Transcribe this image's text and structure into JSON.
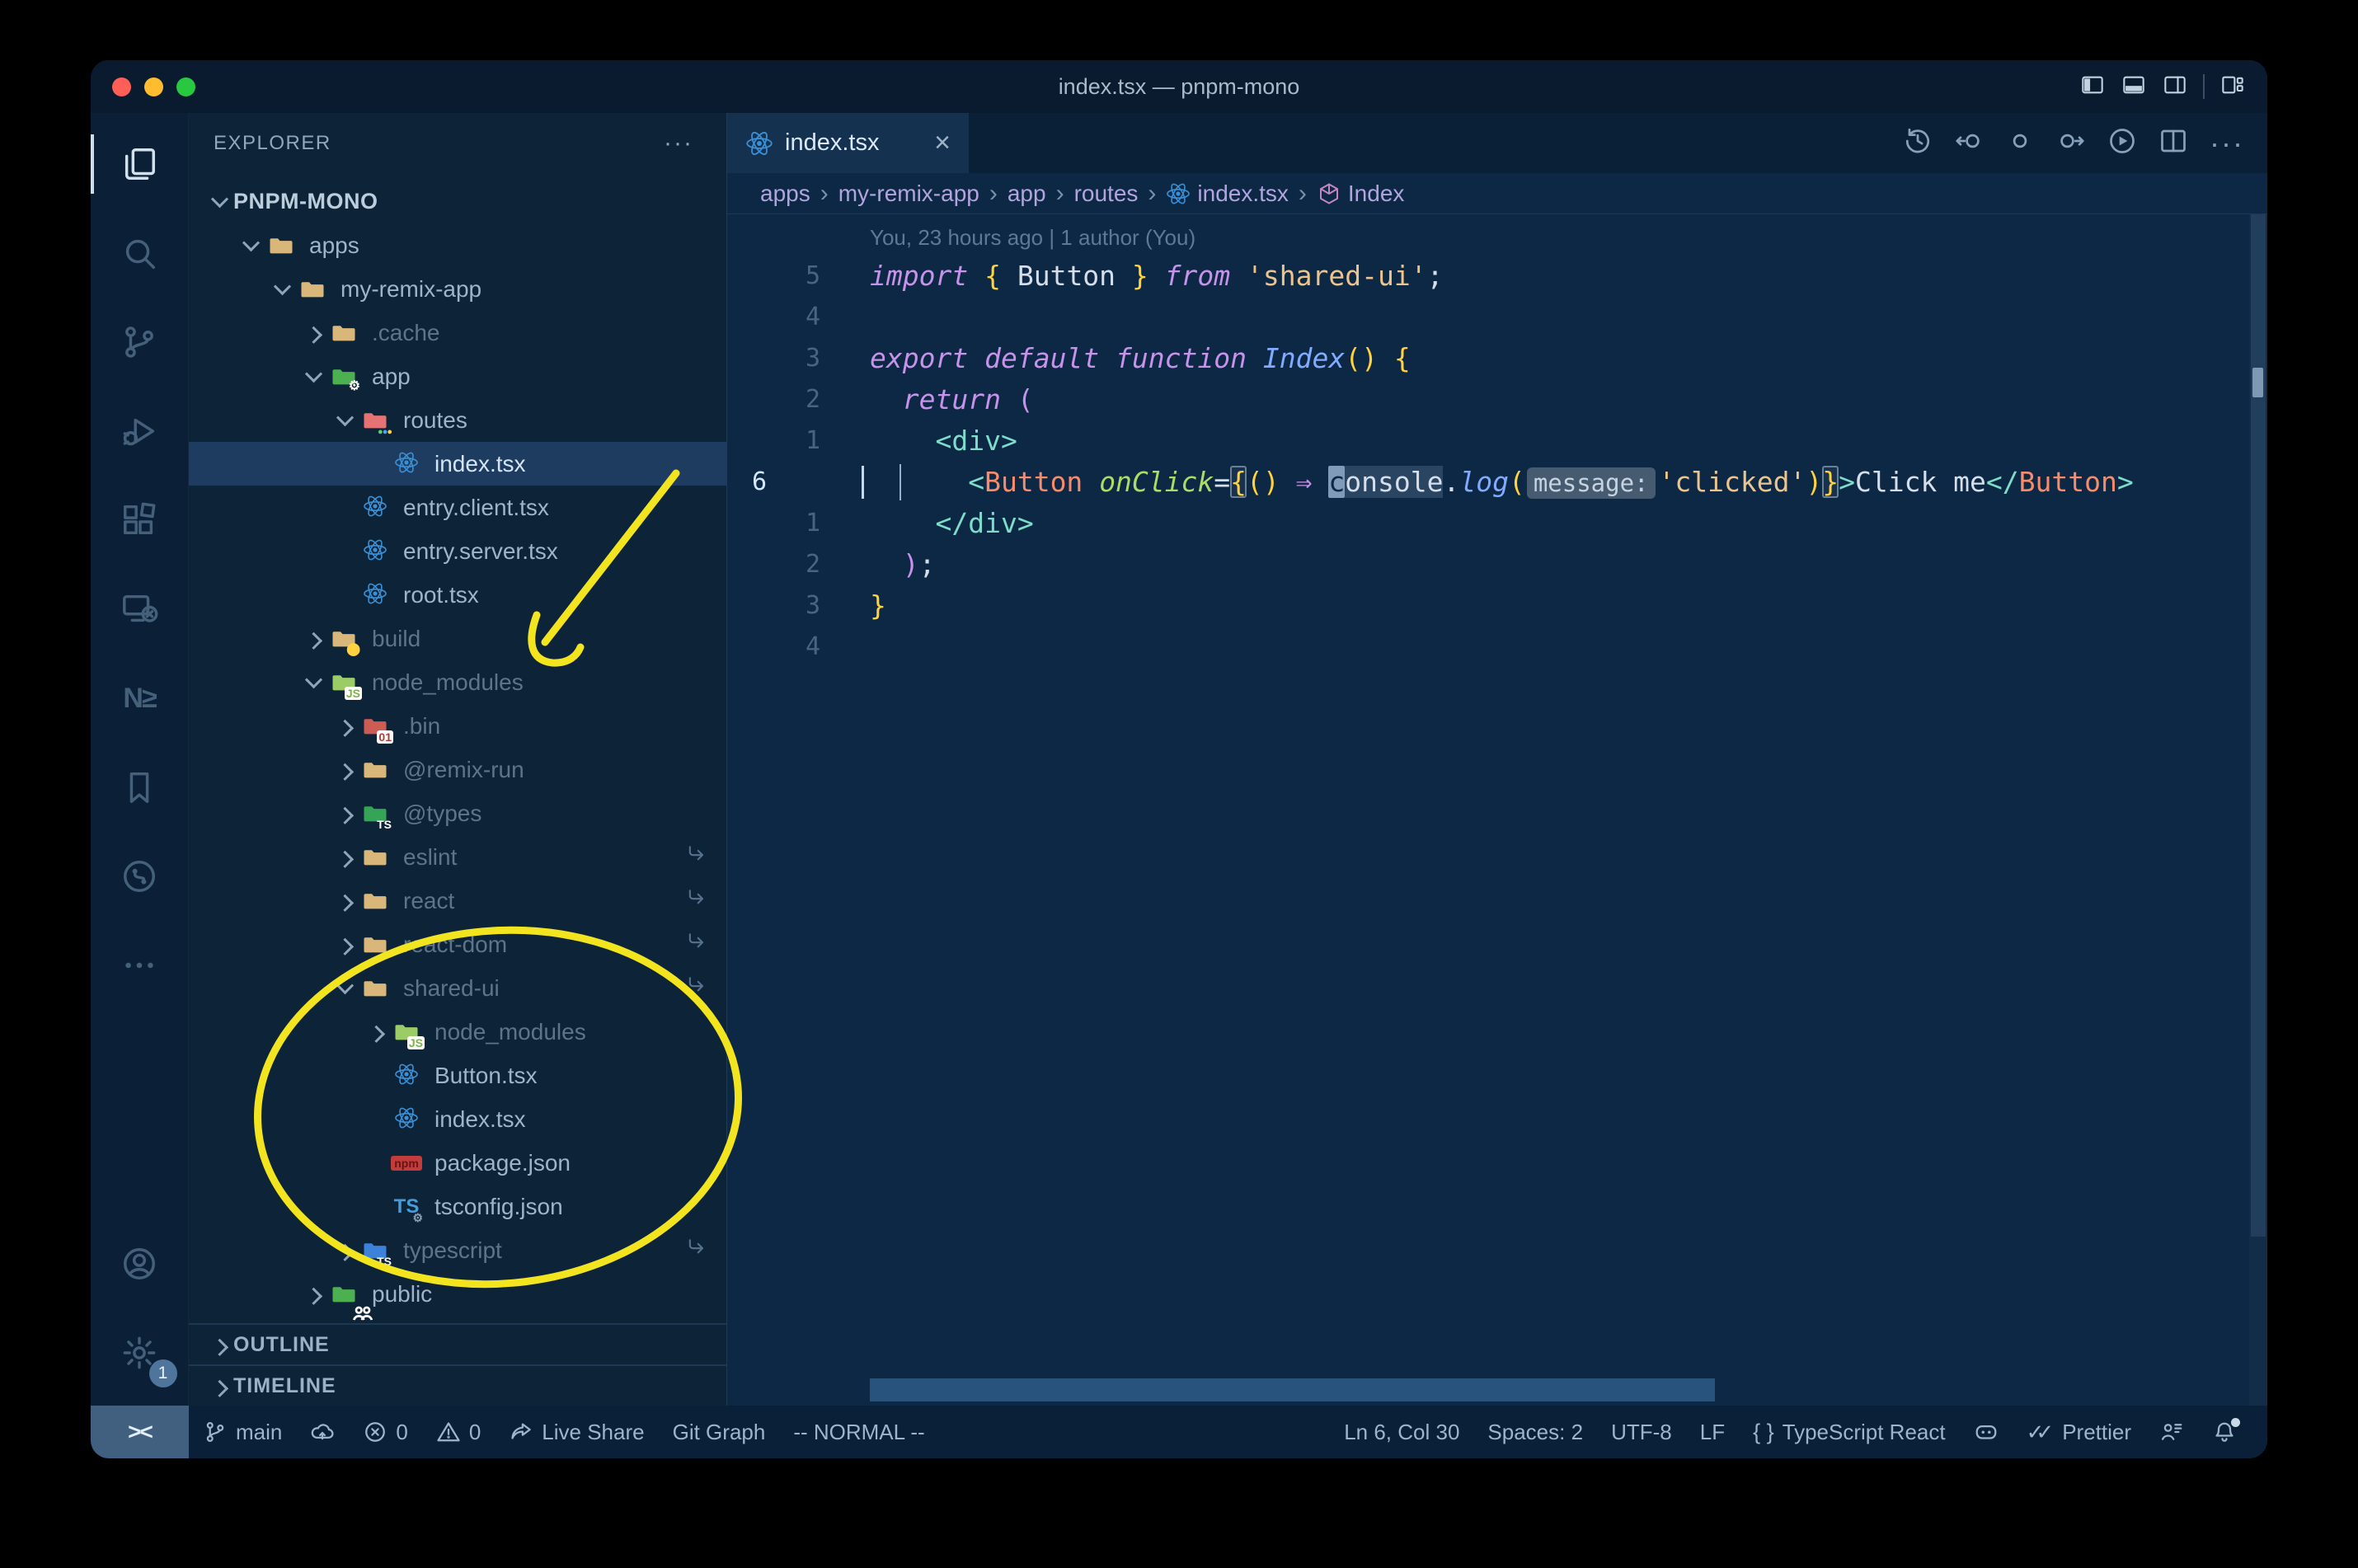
{
  "window": {
    "title": "index.tsx — pnpm-mono"
  },
  "colors": {
    "annotation_yellow": "#f2e41f",
    "editor_bg": "#0c2844",
    "sidebar_bg": "#0d2338",
    "react_blue": "#3b8fd4",
    "keyword_pink": "#c792ea",
    "string_peach": "#ecc48d",
    "bracket_yellow": "#ffd23e",
    "tag_teal": "#7fdbca",
    "component_salmon": "#f78c6c"
  },
  "title_bar": {
    "window_controls": [
      "close",
      "minimize",
      "zoom"
    ],
    "layout_icons": [
      "panel-left",
      "panel-bottom",
      "panel-right",
      "customize-layout"
    ]
  },
  "activity_bar": {
    "top": [
      {
        "name": "explorer",
        "icon": "files",
        "active": true
      },
      {
        "name": "search",
        "icon": "search",
        "active": false
      },
      {
        "name": "source-control",
        "icon": "scm",
        "active": false
      },
      {
        "name": "run-debug",
        "icon": "debug",
        "active": false
      },
      {
        "name": "extensions",
        "icon": "ext",
        "active": false
      },
      {
        "name": "remote-explorer",
        "icon": "remote",
        "active": false
      },
      {
        "name": "nx-console",
        "icon": "nx",
        "active": false,
        "text": "N≥"
      },
      {
        "name": "bookmarks",
        "icon": "bookmark",
        "active": false
      },
      {
        "name": "git-graph",
        "icon": "circlebranch",
        "active": false
      },
      {
        "name": "more-views",
        "icon": "more",
        "active": false
      }
    ],
    "bottom": [
      {
        "name": "accounts",
        "icon": "account"
      },
      {
        "name": "settings",
        "icon": "gear",
        "badge": "1"
      }
    ]
  },
  "sidebar": {
    "header": "EXPLORER",
    "header_menu": "···",
    "root": "PNPM-MONO",
    "tree": [
      {
        "label": "apps",
        "depth": 1,
        "icon": "folder-tan",
        "state": "open"
      },
      {
        "label": "my-remix-app",
        "depth": 2,
        "icon": "folder-tan",
        "state": "open"
      },
      {
        "label": ".cache",
        "depth": 3,
        "icon": "folder-tan",
        "state": "closed",
        "dim": true
      },
      {
        "label": "app",
        "depth": 3,
        "icon": "folder-app",
        "state": "open"
      },
      {
        "label": "routes",
        "depth": 4,
        "icon": "folder-routes",
        "state": "open"
      },
      {
        "label": "index.tsx",
        "depth": 5,
        "icon": "react",
        "state": "none",
        "selected": true
      },
      {
        "label": "entry.client.tsx",
        "depth": 4,
        "icon": "react",
        "state": "none"
      },
      {
        "label": "entry.server.tsx",
        "depth": 4,
        "icon": "react",
        "state": "none"
      },
      {
        "label": "root.tsx",
        "depth": 4,
        "icon": "react",
        "state": "none"
      },
      {
        "label": "build",
        "depth": 3,
        "icon": "folder-build",
        "state": "closed",
        "dim": true
      },
      {
        "label": "node_modules",
        "depth": 3,
        "icon": "folder-nm",
        "state": "open",
        "dim": true
      },
      {
        "label": ".bin",
        "depth": 4,
        "icon": "folder-bin",
        "state": "closed",
        "dim": true
      },
      {
        "label": "@remix-run",
        "depth": 4,
        "icon": "folder-tan",
        "state": "closed",
        "dim": true
      },
      {
        "label": "@types",
        "depth": 4,
        "icon": "folder-types",
        "state": "closed",
        "dim": true
      },
      {
        "label": "eslint",
        "depth": 4,
        "icon": "folder-tan",
        "state": "closed",
        "dim": true,
        "symlink": true
      },
      {
        "label": "react",
        "depth": 4,
        "icon": "folder-tan",
        "state": "closed",
        "dim": true,
        "symlink": true
      },
      {
        "label": "react-dom",
        "depth": 4,
        "icon": "folder-tan",
        "state": "closed",
        "dim": true,
        "symlink": true
      },
      {
        "label": "shared-ui",
        "depth": 4,
        "icon": "folder-tan",
        "state": "open",
        "dim": true,
        "symlink": true
      },
      {
        "label": "node_modules",
        "depth": 5,
        "icon": "folder-nm",
        "state": "closed",
        "dim": true
      },
      {
        "label": "Button.tsx",
        "depth": 5,
        "icon": "react",
        "state": "none"
      },
      {
        "label": "index.tsx",
        "depth": 5,
        "icon": "react",
        "state": "none"
      },
      {
        "label": "package.json",
        "depth": 5,
        "icon": "npm",
        "state": "none"
      },
      {
        "label": "tsconfig.json",
        "depth": 5,
        "icon": "tsconfig",
        "state": "none"
      },
      {
        "label": "typescript",
        "depth": 4,
        "icon": "folder-ts",
        "state": "closed",
        "dim": true,
        "symlink": true
      },
      {
        "label": "public",
        "depth": 3,
        "icon": "folder-public",
        "state": "closed"
      }
    ],
    "sections": [
      "OUTLINE",
      "TIMELINE"
    ]
  },
  "editor": {
    "tab": {
      "label": "index.tsx",
      "icon": "react",
      "close": "×"
    },
    "actions": [
      "history",
      "nav-back",
      "nav-dot",
      "nav-forward",
      "run",
      "split",
      "more"
    ],
    "breadcrumbs": [
      {
        "label": "apps"
      },
      {
        "label": "my-remix-app"
      },
      {
        "label": "app"
      },
      {
        "label": "routes"
      },
      {
        "label": "index.tsx",
        "icon": "react"
      },
      {
        "label": "Index",
        "icon": "cube"
      }
    ],
    "codelens": "You, 23 hours ago | 1 author (You)",
    "lines": [
      {
        "n": "5",
        "t": [
          [
            "k",
            "import"
          ],
          [
            "w",
            " "
          ],
          [
            "y",
            "{"
          ],
          [
            "w",
            " Button "
          ],
          [
            "y",
            "}"
          ],
          [
            "w",
            " "
          ],
          [
            "k",
            "from"
          ],
          [
            "w",
            " "
          ],
          [
            "s",
            "'shared-ui'"
          ],
          [
            "w",
            ";"
          ]
        ]
      },
      {
        "n": "4",
        "t": []
      },
      {
        "n": "3",
        "t": [
          [
            "k",
            "export"
          ],
          [
            "w",
            " "
          ],
          [
            "k",
            "default"
          ],
          [
            "w",
            " "
          ],
          [
            "k",
            "function"
          ],
          [
            "w",
            " "
          ],
          [
            "f",
            "Index"
          ],
          [
            "y",
            "()"
          ],
          [
            "w",
            " "
          ],
          [
            "y",
            "{"
          ]
        ]
      },
      {
        "n": "2",
        "t": [
          [
            "w",
            "  "
          ],
          [
            "k",
            "return"
          ],
          [
            "w",
            " "
          ],
          [
            "p",
            "("
          ]
        ]
      },
      {
        "n": "1",
        "t": [
          [
            "w",
            "    "
          ],
          [
            "t",
            "<div>"
          ]
        ]
      },
      {
        "n": "6",
        "cur": true,
        "t": [
          [
            "w",
            "      "
          ],
          [
            "t",
            "<"
          ],
          [
            "c",
            "Button"
          ],
          [
            "w",
            " "
          ],
          [
            "a",
            "onClick"
          ],
          [
            "w",
            "="
          ],
          [
            "yb",
            "{"
          ],
          [
            "y",
            "()"
          ],
          [
            "w",
            " "
          ],
          [
            "ar",
            "⇒"
          ],
          [
            "w",
            " "
          ],
          [
            "cur",
            "c"
          ],
          [
            "whl",
            "onsole"
          ],
          [
            "w",
            "."
          ],
          [
            "f",
            "log"
          ],
          [
            "y",
            "("
          ],
          [
            "inlay",
            "message:"
          ],
          [
            "s",
            "'clicked'"
          ],
          [
            "y",
            ")"
          ],
          [
            "yb",
            "}"
          ],
          [
            "t",
            ">"
          ],
          [
            "w",
            "Click me"
          ],
          [
            "t",
            "</"
          ],
          [
            "c",
            "Button"
          ],
          [
            "t",
            ">"
          ]
        ]
      },
      {
        "n": "1",
        "t": [
          [
            "w",
            "    "
          ],
          [
            "t",
            "</div>"
          ]
        ]
      },
      {
        "n": "2",
        "t": [
          [
            "w",
            "  "
          ],
          [
            "p",
            ")"
          ],
          [
            "w",
            ";"
          ]
        ]
      },
      {
        "n": "3",
        "t": [
          [
            "y",
            "}"
          ]
        ]
      },
      {
        "n": "4",
        "t": []
      }
    ]
  },
  "status_bar": {
    "left": [
      {
        "name": "remote-indicator",
        "icon": "remote-text",
        "label": "><"
      },
      {
        "name": "git-branch",
        "icon": "branch",
        "label": "main"
      },
      {
        "name": "sync",
        "icon": "cloudup",
        "label": ""
      },
      {
        "name": "errors",
        "icon": "errc",
        "label": "0"
      },
      {
        "name": "warnings",
        "icon": "warn",
        "label": "0"
      },
      {
        "name": "live-share",
        "icon": "share",
        "label": "Live Share"
      },
      {
        "name": "git-graph",
        "icon": "",
        "label": "Git Graph"
      },
      {
        "name": "vim-mode",
        "icon": "",
        "label": "-- NORMAL --"
      }
    ],
    "right": [
      {
        "name": "cursor-position",
        "icon": "",
        "label": "Ln 6, Col 30"
      },
      {
        "name": "indentation",
        "icon": "",
        "label": "Spaces: 2"
      },
      {
        "name": "encoding",
        "icon": "",
        "label": "UTF-8"
      },
      {
        "name": "eol",
        "icon": "",
        "label": "LF"
      },
      {
        "name": "language-mode",
        "icon": "braces",
        "label": "TypeScript React"
      },
      {
        "name": "copilot",
        "icon": "copilot",
        "label": ""
      },
      {
        "name": "prettier",
        "icon": "checks",
        "label": "Prettier"
      },
      {
        "name": "feedback",
        "icon": "feedback",
        "label": ""
      },
      {
        "name": "notifications",
        "icon": "bell",
        "label": "",
        "badge": true
      }
    ]
  },
  "annotations": {
    "color": "#f2e41f",
    "items": [
      "hand-drawn arrow pointing to node_modules",
      "hand-drawn ellipse around shared-ui package contents"
    ]
  }
}
